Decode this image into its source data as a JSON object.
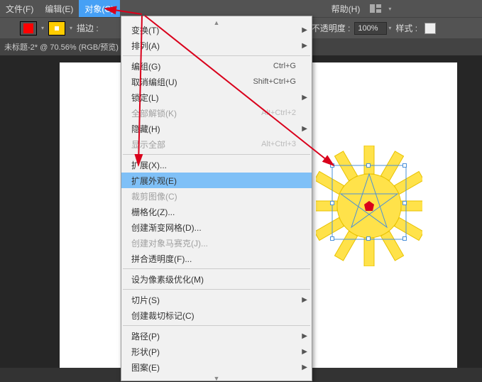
{
  "menubar": {
    "file": "文件(F)",
    "edit": "编辑(E)",
    "object": "对象(O)",
    "help": "帮助(H)"
  },
  "toolbar": {
    "stroke_label": "描边 :",
    "opacity_label": "不透明度 :",
    "opacity_value": "100%",
    "style_label": "样式 :"
  },
  "tab": {
    "title": "未标题-2* @ 70.56% (RGB/预览)"
  },
  "menu": {
    "transform": "变换(T)",
    "arrange": "排列(A)",
    "group": "编组(G)",
    "group_sc": "Ctrl+G",
    "ungroup": "取消编组(U)",
    "ungroup_sc": "Shift+Ctrl+G",
    "lock": "锁定(L)",
    "unlockall": "全部解锁(K)",
    "unlockall_sc": "Alt+Ctrl+2",
    "hide": "隐藏(H)",
    "showall": "显示全部",
    "showall_sc": "Alt+Ctrl+3",
    "expand": "扩展(X)...",
    "expandapp": "扩展外观(E)",
    "crop": "裁剪图像(C)",
    "raster": "栅格化(Z)...",
    "gradmesh": "创建渐变网格(D)...",
    "mosaic": "创建对象马赛克(J)...",
    "flatten": "拼合透明度(F)...",
    "pixelperfect": "设为像素级优化(M)",
    "slice": "切片(S)",
    "trimmarks": "创建裁切标记(C)",
    "path": "路径(P)",
    "shape_m": "形状(P)",
    "pattern": "图案(E)"
  },
  "colors": {
    "fill": "#ff0000",
    "aux": "#ffcc00"
  }
}
